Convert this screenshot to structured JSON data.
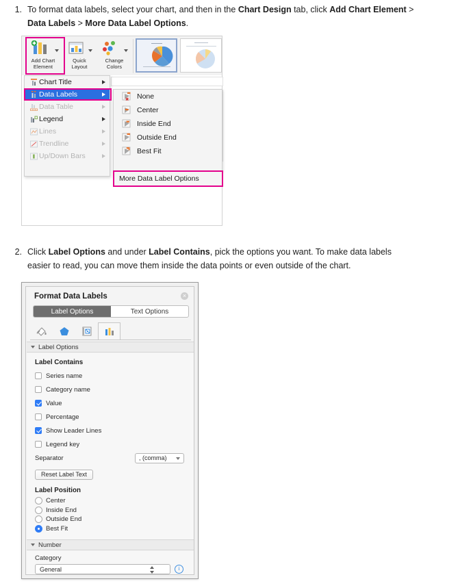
{
  "steps": [
    {
      "number": "1.",
      "segments": [
        {
          "text": "To format data labels, select your chart, and then in the ",
          "bold": false
        },
        {
          "text": "Chart Design",
          "bold": true
        },
        {
          "text": " tab, click ",
          "bold": false
        },
        {
          "text": "Add Chart Element",
          "bold": true
        },
        {
          "text": " > ",
          "bold": false
        },
        {
          "text": "Data Labels",
          "bold": true
        },
        {
          "text": " > ",
          "bold": false
        },
        {
          "text": "More Data Label Options",
          "bold": true
        },
        {
          "text": ".",
          "bold": false
        }
      ]
    },
    {
      "number": "2.",
      "segments": [
        {
          "text": "Click ",
          "bold": false
        },
        {
          "text": "Label Options",
          "bold": true
        },
        {
          "text": " and under ",
          "bold": false
        },
        {
          "text": "Label Contains",
          "bold": true
        },
        {
          "text": ", pick the options you want. To make data labels easier to read, you can move them inside the data points or even outside of the chart.",
          "bold": false
        }
      ]
    }
  ],
  "ribbon": {
    "groups": [
      {
        "label_line1": "Add Chart",
        "label_line2": "Element",
        "icon": "add-chart-element-icon",
        "highlighted": true
      },
      {
        "label_line1": "Quick",
        "label_line2": "Layout",
        "icon": "quick-layout-icon",
        "highlighted": false
      },
      {
        "label_line1": "Change",
        "label_line2": "Colors",
        "icon": "change-colors-icon",
        "highlighted": false
      }
    ],
    "gallery": [
      {
        "name": "chart-style-1",
        "selected": true
      },
      {
        "name": "chart-style-2",
        "selected": false
      }
    ]
  },
  "add_chart_element_menu": {
    "items": [
      {
        "label": "Chart Title",
        "icon": "chart-title-icon",
        "disabled": false,
        "selected": false,
        "has_submenu": true
      },
      {
        "label": "Data Labels",
        "icon": "data-labels-icon",
        "disabled": false,
        "selected": true,
        "has_submenu": true
      },
      {
        "label": "Data Table",
        "icon": "data-table-icon",
        "disabled": true,
        "selected": false,
        "has_submenu": true
      },
      {
        "label": "Legend",
        "icon": "legend-icon",
        "disabled": false,
        "selected": false,
        "has_submenu": true
      },
      {
        "label": "Lines",
        "icon": "lines-icon",
        "disabled": true,
        "selected": false,
        "has_submenu": true
      },
      {
        "label": "Trendline",
        "icon": "trendline-icon",
        "disabled": true,
        "selected": false,
        "has_submenu": true
      },
      {
        "label": "Up/Down Bars",
        "icon": "updown-bars-icon",
        "disabled": true,
        "selected": false,
        "has_submenu": true
      }
    ]
  },
  "data_labels_submenu": {
    "items": [
      {
        "label": "None",
        "icon": "label-none-icon"
      },
      {
        "label": "Center",
        "icon": "label-center-icon"
      },
      {
        "label": "Inside End",
        "icon": "label-inside-end-icon"
      },
      {
        "label": "Outside End",
        "icon": "label-outside-end-icon"
      },
      {
        "label": "Best Fit",
        "icon": "label-best-fit-icon"
      }
    ],
    "more_options": "More Data Label Options"
  },
  "format_panel": {
    "title": "Format Data Labels",
    "close_icon": "close-icon",
    "tabs": [
      {
        "label": "Label Options",
        "active": true
      },
      {
        "label": "Text Options",
        "active": false
      }
    ],
    "icon_tabs": [
      {
        "name": "fill-and-line-icon",
        "active": false
      },
      {
        "name": "effects-icon",
        "active": false
      },
      {
        "name": "size-and-properties-icon",
        "active": false
      },
      {
        "name": "label-options-chart-icon",
        "active": true
      }
    ],
    "sections": [
      {
        "title": "Label Options",
        "expanded": true
      },
      {
        "title": "Number",
        "expanded": true
      }
    ],
    "label_contains": {
      "heading": "Label Contains",
      "checkboxes": [
        {
          "label": "Series name",
          "checked": false
        },
        {
          "label": "Category name",
          "checked": false
        },
        {
          "label": "Value",
          "checked": true
        },
        {
          "label": "Percentage",
          "checked": false
        },
        {
          "label": "Show Leader Lines",
          "checked": true
        },
        {
          "label": "Legend key",
          "checked": false
        }
      ],
      "separator_label": "Separator",
      "separator_value": ", (comma)",
      "reset_button": "Reset Label Text"
    },
    "label_position": {
      "heading": "Label Position",
      "options": [
        {
          "label": "Center",
          "selected": false
        },
        {
          "label": "Inside End",
          "selected": false
        },
        {
          "label": "Outside End",
          "selected": false
        },
        {
          "label": "Best Fit",
          "selected": true
        }
      ]
    },
    "number": {
      "category_label": "Category",
      "category_value": "General",
      "info_icon": "info-icon"
    }
  },
  "colors": {
    "highlight_pink": "#e3008c",
    "menu_selection_blue": "#2b6fe0",
    "checkbox_blue": "#2f7cf6",
    "panel_bg": "#f4f4f4",
    "text": "#212121"
  }
}
